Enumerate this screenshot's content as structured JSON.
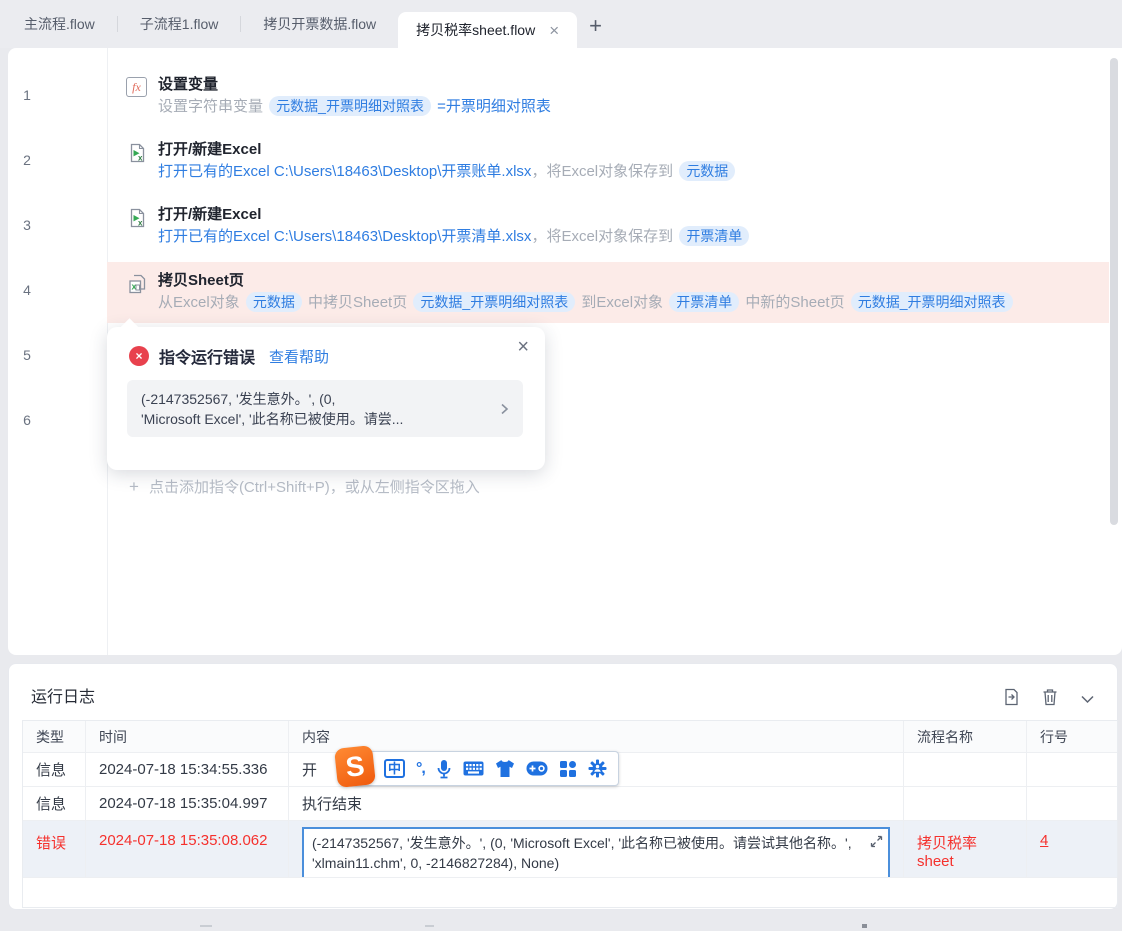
{
  "tab_bar": {
    "tabs": [
      {
        "label": "主流程.flow"
      },
      {
        "label": "子流程1.flow"
      },
      {
        "label": "拷贝开票数据.flow"
      },
      {
        "label": "拷贝税率sheet.flow"
      }
    ],
    "close_label": "×",
    "new_tab_label": "+"
  },
  "flow": {
    "line_numbers": [
      "1",
      "2",
      "3",
      "4",
      "5",
      "6"
    ],
    "steps": [
      {
        "title": "设置变量",
        "t1": "设置字符串变量 ",
        "p1": "元数据_开票明细对照表",
        "t2": " =开票明细对照表"
      },
      {
        "title": "打开/新建Excel",
        "link": "打开已有的Excel C:\\Users\\18463\\Desktop\\开票账单.xlsx",
        "t1": "，",
        "t2": "将Excel对象保存到 ",
        "p1": "元数据"
      },
      {
        "title": "打开/新建Excel",
        "link": "打开已有的Excel C:\\Users\\18463\\Desktop\\开票清单.xlsx",
        "t1": "，",
        "t2": "将Excel对象保存到 ",
        "p1": "开票清单"
      },
      {
        "title": "拷贝Sheet页",
        "t1": "从Excel对象 ",
        "p1": "元数据",
        "t2": " 中拷贝Sheet页 ",
        "p2": "元数据_开票明细对照表",
        "t3": " 到Excel对象 ",
        "p3": "开票清单",
        "t4": " 中新的Sheet页 ",
        "p4": "元数据_开票明细对照表"
      }
    ],
    "add_plus": "+",
    "add_instruction": "点击添加指令(Ctrl+Shift+P)，或从左侧指令区拖入"
  },
  "error_popover": {
    "badge": "×",
    "title": "指令运行错误",
    "help_link": "查看帮助",
    "close": "×",
    "message_line1": "(-2147352567, '发生意外。', (0,",
    "message_line2": "'Microsoft Excel', '此名称已被使用。请尝..."
  },
  "run_log": {
    "title": "运行日志",
    "columns": [
      "类型",
      "时间",
      "内容",
      "流程名称",
      "行号"
    ],
    "rows": [
      {
        "type": "信息",
        "time": "2024-07-18 15:34:55.336",
        "content": "开"
      },
      {
        "type": "信息",
        "time": "2024-07-18 15:35:04.997",
        "content": "执行结束"
      },
      {
        "type": "错误",
        "time": "2024-07-18 15:35:08.062",
        "content": "(-2147352567, '发生意外。', (0, 'Microsoft Excel', '此名称已被使用。请尝试其他名称。', 'xlmain11.chm', 0, -2146827284), None)",
        "flow_name": "拷贝税率sheet",
        "line_no": "4"
      }
    ]
  },
  "ime_toolbar": {
    "logo": "S",
    "mode_label": "中",
    "punctuation_label": "°,",
    "icons": [
      "sogou-logo",
      "chinese-mode-icon",
      "punctuation-icon",
      "microphone-icon",
      "keyboard-icon",
      "skin-icon",
      "toolbox-icon",
      "apps-grid-icon",
      "settings-icon"
    ]
  },
  "colors": {
    "accent_blue": "#2f7de1",
    "pill_bg": "#e1edfc",
    "error_red": "#f5312d",
    "error_badge": "#e8414d",
    "selected_row_pink": "#fcebe8",
    "error_row_bg": "#edf1f7",
    "err_box_border": "#4b8fdb",
    "sogou_orange": "#ef5a0d",
    "ime_blue": "#1f71e0"
  }
}
